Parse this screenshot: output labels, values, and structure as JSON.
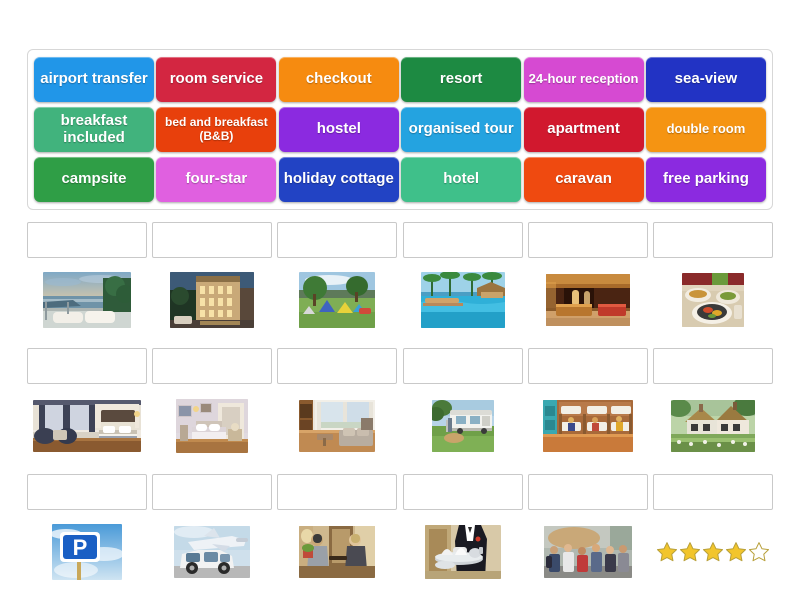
{
  "activity": {
    "type": "match-up",
    "columns": 6,
    "rows": 3
  },
  "tile_bank": {
    "rows": [
      [
        {
          "label": "airport transfer",
          "color": "#2196e8",
          "size": "normal"
        },
        {
          "label": "room service",
          "color": "#d32641",
          "size": "normal"
        },
        {
          "label": "checkout",
          "color": "#f68b10",
          "size": "normal"
        },
        {
          "label": "resort",
          "color": "#1d8a42",
          "size": "normal"
        },
        {
          "label": "24-hour reception",
          "color": "#d64ad2",
          "size": "small"
        },
        {
          "label": "sea-view",
          "color": "#2233c4",
          "size": "normal"
        }
      ],
      [
        {
          "label": "breakfast included",
          "color": "#41b37d",
          "size": "normal"
        },
        {
          "label": "bed and breakfast (B&B)",
          "color": "#e8400c",
          "size": "xsmall"
        },
        {
          "label": "hostel",
          "color": "#8b2ae0",
          "size": "normal"
        },
        {
          "label": "organised tour",
          "color": "#24a3e0",
          "size": "normal"
        },
        {
          "label": "apartment",
          "color": "#d1182e",
          "size": "normal"
        },
        {
          "label": "double room",
          "color": "#f59412",
          "size": "small"
        }
      ],
      [
        {
          "label": "campsite",
          "color": "#2f9e46",
          "size": "normal"
        },
        {
          "label": "four-star",
          "color": "#e060e0",
          "size": "normal"
        },
        {
          "label": "holiday cottage",
          "color": "#2243c4",
          "size": "normal"
        },
        {
          "label": "hotel",
          "color": "#3fc08a",
          "size": "normal"
        },
        {
          "label": "caravan",
          "color": "#ef4a10",
          "size": "normal"
        },
        {
          "label": "free parking",
          "color": "#8b2ae0",
          "size": "normal"
        }
      ]
    ]
  },
  "answer_grid": {
    "dropzone_value": "",
    "rows": [
      {
        "items": [
          {
            "image_name": "sea-view-terrace-photo",
            "alt": "sea-view terrace with loungers at sunset"
          },
          {
            "image_name": "grand-hotel-facade-photo",
            "alt": "grand hotel building at dusk"
          },
          {
            "image_name": "campsite-tents-photo",
            "alt": "tents pitched on a green campsite"
          },
          {
            "image_name": "resort-pool-photo",
            "alt": "resort swimming pool with palm trees"
          },
          {
            "image_name": "hotel-reception-lobby-photo",
            "alt": "hotel reception lobby desk"
          },
          {
            "image_name": "breakfast-plate-photo",
            "alt": "breakfast food plate on table"
          }
        ]
      },
      {
        "items": [
          {
            "image_name": "double-room-bedroom-photo",
            "alt": "double room with large bed"
          },
          {
            "image_name": "bed-and-breakfast-room-photo",
            "alt": "bed and breakfast guest room"
          },
          {
            "image_name": "apartment-living-room-photo",
            "alt": "apartment living room and kitchen"
          },
          {
            "image_name": "caravan-photo",
            "alt": "caravan parked on grass"
          },
          {
            "image_name": "hostel-dormitory-photo",
            "alt": "hostel dormitory with bunk beds"
          },
          {
            "image_name": "holiday-cottage-photo",
            "alt": "thatched holiday cottage with garden"
          }
        ]
      },
      {
        "items": [
          {
            "image_name": "parking-sign-photo",
            "alt": "blue parking P sign against sky"
          },
          {
            "image_name": "airport-transfer-van-photo",
            "alt": "airport transfer van with aeroplane"
          },
          {
            "image_name": "checkout-desk-photo",
            "alt": "guest checking out at hotel desk"
          },
          {
            "image_name": "room-service-waiter-photo",
            "alt": "waiter carrying room service tray"
          },
          {
            "image_name": "organised-tour-group-photo",
            "alt": "tour guide with group of tourists"
          },
          {
            "image_name": "four-star-rating-graphic",
            "alt": "four filled gold stars and one empty star"
          }
        ]
      }
    ]
  },
  "star_rating": {
    "filled": 4,
    "total": 5,
    "filled_color": "#f2c52c",
    "empty_color": "#ffffff",
    "outline_color": "#b8a03a"
  },
  "colors": {
    "panel_border": "#d7d7d7",
    "dropzone_border": "#c9c9c9",
    "background": "#ffffff"
  }
}
